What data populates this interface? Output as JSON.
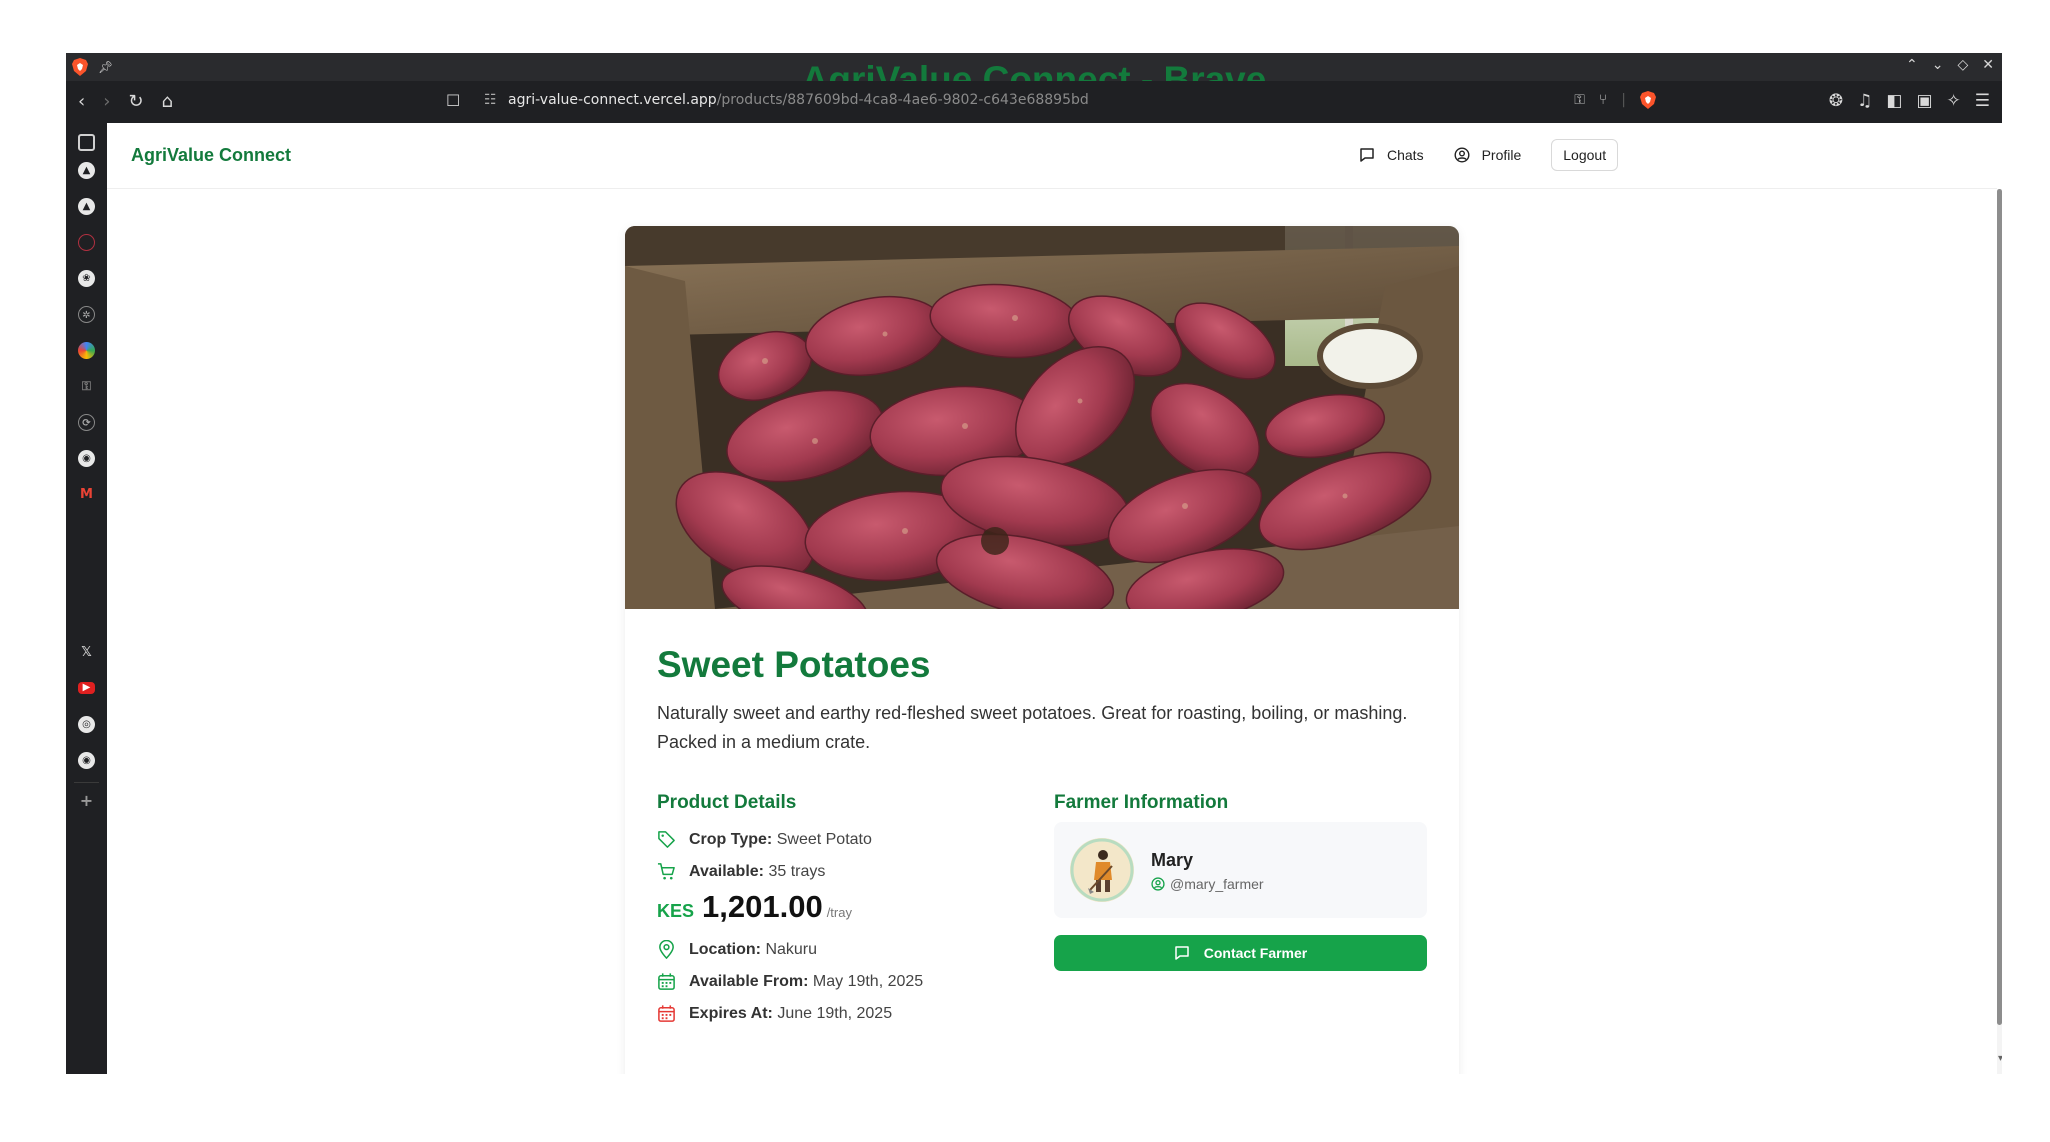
{
  "browser": {
    "window_title": "AgriValue Connect - Brave",
    "url_host": "agri-value-connect.vercel.app",
    "url_path": "/products/887609bd-4ca8-4ae6-9802-c643e68895bd"
  },
  "app": {
    "brand": "AgriValue Connect",
    "nav": {
      "chats": "Chats",
      "profile": "Profile",
      "logout": "Logout"
    }
  },
  "product": {
    "image_alt": "Sweet potatoes in a wooden crate",
    "title": "Sweet Potatoes",
    "description": "Naturally sweet and earthy red-fleshed sweet potatoes. Great for roasting, boiling, or mashing. Packed in a medium crate.",
    "details_heading": "Product Details",
    "crop_type_label": "Crop Type:",
    "crop_type_value": "Sweet Potato",
    "available_label": "Available:",
    "available_value": "35 trays",
    "price_currency": "KES",
    "price_amount": "1,201.00",
    "price_unit": "/tray",
    "location_label": "Location:",
    "location_value": "Nakuru",
    "available_from_label": "Available From:",
    "available_from_value": "May 19th, 2025",
    "expires_label": "Expires At:",
    "expires_value": "June 19th, 2025"
  },
  "farmer": {
    "heading": "Farmer Information",
    "name": "Mary",
    "handle": "@mary_farmer",
    "contact_label": "Contact Farmer"
  },
  "colors": {
    "brand_green": "#137a3c",
    "button_green": "#16a34a",
    "expires_red": "#e53935"
  }
}
